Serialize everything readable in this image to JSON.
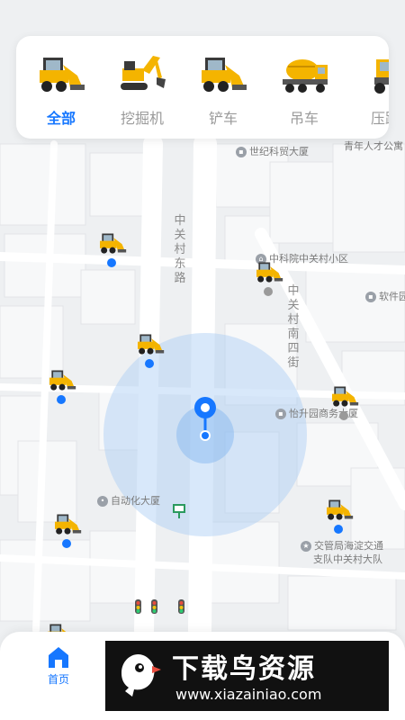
{
  "categories": [
    {
      "label": "全部",
      "icon": "skid-steer-loader-icon",
      "active": true
    },
    {
      "label": "挖掘机",
      "icon": "excavator-icon",
      "active": false
    },
    {
      "label": "铲车",
      "icon": "skid-steer-loader-icon",
      "active": false
    },
    {
      "label": "吊车",
      "icon": "concrete-mixer-truck-icon",
      "active": false
    },
    {
      "label": "压路",
      "icon": "road-roller-icon",
      "active": false
    }
  ],
  "map": {
    "pois": {
      "shimao": "世纪科贸大厦",
      "qingnian": "青年人才公寓",
      "zgc_xiaoqu": "中科院中关村小区",
      "ruanjian": "软件园",
      "yisheng": "怡升园商务大厦",
      "zidonghua": "自动化大厦",
      "jiaojing_1": "交管局海淀交通",
      "jiaojing_2": "支队中关村大队"
    },
    "roads": {
      "east": "中关村东路",
      "south4": "中关村南四街"
    },
    "colors": {
      "accent": "#1677ff",
      "online_dot": "#1677ff",
      "offline_dot": "#9a9a9a",
      "range_circle": "#a9cdf5"
    }
  },
  "nav": {
    "home_label": "首页"
  },
  "watermark": {
    "title": "下载鸟资源",
    "url": "www.xiazainiao.com"
  }
}
